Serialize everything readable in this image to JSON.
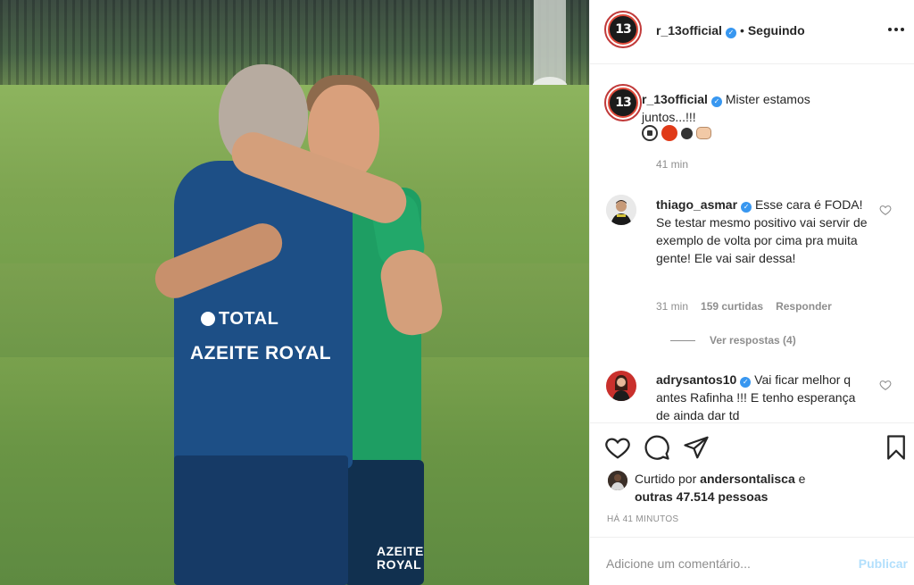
{
  "post": {
    "photo_text": {
      "sponsor1": "TOTAL",
      "sponsor2": "AZEITE ROYAL",
      "shorts_line1": "AZEITE",
      "shorts_line2": "ROYAL"
    }
  },
  "header": {
    "username": "r_13official",
    "avatar_label": "13",
    "separator": "•",
    "follow_status": "Seguindo"
  },
  "caption": {
    "username": "r_13official",
    "text": "Mister estamos juntos...!!!",
    "emojis": [
      "soccer-ball",
      "red-circle",
      "black-circle",
      "fist-bump"
    ],
    "time": "41 min"
  },
  "comments": [
    {
      "username": "thiago_asmar",
      "verified": true,
      "text": "Esse cara é FODA! Se testar mesmo positivo vai servir de exemplo de volta por cima pra muita gente! Ele vai sair dessa!",
      "time": "31 min",
      "likes": "159 curtidas",
      "reply_label": "Responder",
      "view_replies": "Ver respostas (4)"
    },
    {
      "username": "adrysantos10",
      "verified": true,
      "text": "Vai ficar melhor q antes Rafinha !!! E tenho esperança de ainda dar td"
    }
  ],
  "actions": {
    "icons": [
      "heart-icon",
      "comment-icon",
      "share-icon",
      "bookmark-icon"
    ],
    "liked_prefix": "Curtido por",
    "liked_user": "andersontalisca",
    "liked_and": "e",
    "liked_others": "outras 47.514 pessoas",
    "ago": "HÁ 41 MINUTOS"
  },
  "add_comment": {
    "placeholder": "Adicione um comentário...",
    "publish": "Publicar"
  },
  "colors": {
    "verified": "#3897f0",
    "publish_disabled": "#b2dffc",
    "muted": "#8e8e8e",
    "text": "#262626"
  }
}
